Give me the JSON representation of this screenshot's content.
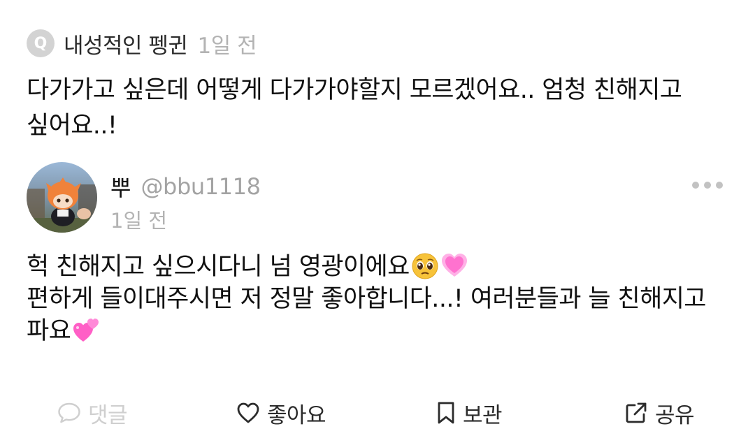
{
  "question": {
    "badge_letter": "Q",
    "author": "내성적인 펭귄",
    "time": "1일 전",
    "text_line1": "다가가고 싶은데 어떻게 다가가야할지 모르겠어요.. 엄청 친해지고",
    "text_line2": "싶어요..!"
  },
  "answer": {
    "name": "뿌",
    "handle": "@bbu1118",
    "time": "1일 전",
    "line1": "헉 친해지고 싶으시다니 넘 영광이에요",
    "line2": "편하게 들이대주시면 저 정말 좋아합니다...! 여러분들과 늘 친해지고",
    "line3": "파요"
  },
  "actions": {
    "comment": "댓글",
    "like": "좋아요",
    "save": "보관",
    "share": "공유"
  },
  "icons": {
    "question_badge": "q-badge-icon",
    "avatar": "avatar-plush-photo",
    "more": "more-dots-icon",
    "emoji1": "pleading-face-emoji",
    "emoji2": "growing-heart-emoji",
    "emoji3": "two-hearts-emoji",
    "comment": "speech-bubble-icon",
    "like": "heart-icon",
    "save": "bookmark-icon",
    "share": "share-icon"
  },
  "colors": {
    "text": "#111111",
    "meta": "#b3b3b3",
    "disabled": "#cfcfcf",
    "badge": "#d3d3d3",
    "heart_pink": "#ff6fcf"
  }
}
